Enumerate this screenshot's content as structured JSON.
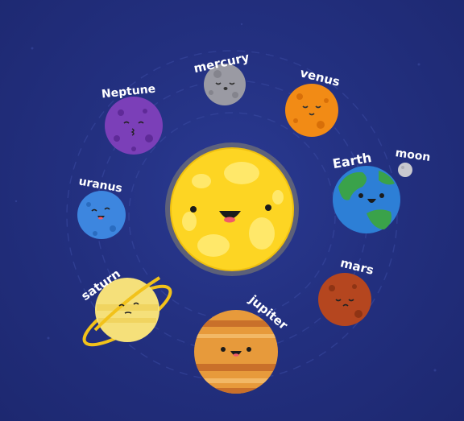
{
  "labels": {
    "mercury": "mercury",
    "venus": "venus",
    "neptune": "Neptune",
    "earth": "Earth",
    "moon": "moon",
    "uranus": "uranus",
    "mars": "mars",
    "saturn": "saturn",
    "jupiter": "jupiter"
  },
  "colors": {
    "background": "#24307f",
    "sun": "#fdd523",
    "mercury": "#9a9aa3",
    "venus": "#f28b15",
    "neptune": "#7b3fb8",
    "earth": "#3aa24a",
    "earth_ocean": "#2d7fd6",
    "moon": "#c9c9cf",
    "uranus": "#3d86df",
    "mars": "#b5461f",
    "saturn": "#f5e07a",
    "saturn_ring": "#f2c21a",
    "jupiter": "#e79a3b"
  }
}
